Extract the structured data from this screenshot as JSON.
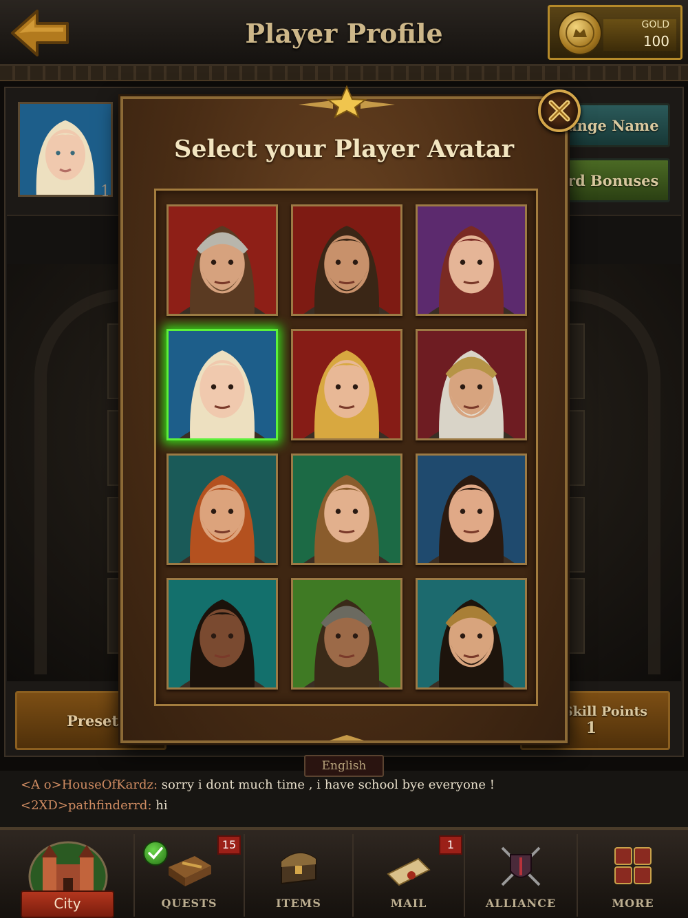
{
  "header": {
    "title": "Player Profile",
    "gold_label": "GOLD",
    "gold_value": "100"
  },
  "background_panel": {
    "level": "1",
    "change_name_label": "ange Name",
    "bonuses_label": "rd Bonuses",
    "presets_label": "Presets",
    "skill_points_label": "n Skill Points",
    "skill_points_value": "1"
  },
  "modal": {
    "title": "Select your Player Avatar",
    "selected_index": 3,
    "avatars": [
      {
        "name": "avatar-bearded-warrior-helmet",
        "bg": "#8e1f17",
        "skin": "#d6a27e",
        "hair": "#5a3a22",
        "beard": "#6b4a2e",
        "helm": "#b8b6ac"
      },
      {
        "name": "avatar-dark-haired-man",
        "bg": "#7e1b13",
        "skin": "#c8916b",
        "hair": "#3a2616",
        "beard": "#3a2616",
        "helm": ""
      },
      {
        "name": "avatar-red-haired-woman",
        "bg": "#5c2a6e",
        "skin": "#e5b597",
        "hair": "#7a2a23",
        "beard": "",
        "helm": ""
      },
      {
        "name": "avatar-blonde-queen",
        "bg": "#1d5e8a",
        "skin": "#f0c9ae",
        "hair": "#ede0c0",
        "beard": "",
        "helm": ""
      },
      {
        "name": "avatar-painted-warrior-woman",
        "bg": "#861c16",
        "skin": "#e8b896",
        "hair": "#d8a840",
        "beard": "",
        "helm": ""
      },
      {
        "name": "avatar-old-king",
        "bg": "#6e1c22",
        "skin": "#d7a47f",
        "hair": "#d9d4c8",
        "beard": "#e4ded2",
        "helm": "#b69446"
      },
      {
        "name": "avatar-ginger-bearded-man",
        "bg": "#1a5a58",
        "skin": "#dca37c",
        "hair": "#b4511f",
        "beard": "#b4511f",
        "helm": ""
      },
      {
        "name": "avatar-noble-lady",
        "bg": "#1c6a45",
        "skin": "#e2b08d",
        "hair": "#8a5c2c",
        "beard": "",
        "helm": ""
      },
      {
        "name": "avatar-braided-woman",
        "bg": "#1f4a6e",
        "skin": "#e0a987",
        "hair": "#2b1a10",
        "beard": "",
        "helm": ""
      },
      {
        "name": "avatar-tribal-warrior",
        "bg": "#13706c",
        "skin": "#7a4a30",
        "hair": "#1b120b",
        "beard": "",
        "helm": ""
      },
      {
        "name": "avatar-armored-woman",
        "bg": "#3f7a24",
        "skin": "#9c6a48",
        "hair": "#3a2a18",
        "beard": "",
        "helm": "#6b6a60"
      },
      {
        "name": "avatar-eastern-warrior",
        "bg": "#1c6a6e",
        "skin": "#d8a47d",
        "hair": "#1d140c",
        "beard": "#2a1a10",
        "helm": "#a97f36"
      }
    ]
  },
  "chat": {
    "language": "English",
    "messages": [
      {
        "name": "<A o>HouseOfKardz:",
        "text": " sorry i dont much time , i have school bye everyone !"
      },
      {
        "name": "<2XD>pathfinderrd:",
        "text": " hi"
      }
    ]
  },
  "nav": {
    "city": "City",
    "quests": "QUESTS",
    "quests_badge": "15",
    "items": "ITEMS",
    "mail": "MAIL",
    "mail_badge": "1",
    "alliance": "ALLIANCE",
    "more": "MORE"
  },
  "colors": {
    "accent_gold": "#d4a64a",
    "selected_glow": "#37d01a",
    "badge_red": "#9b2018"
  }
}
